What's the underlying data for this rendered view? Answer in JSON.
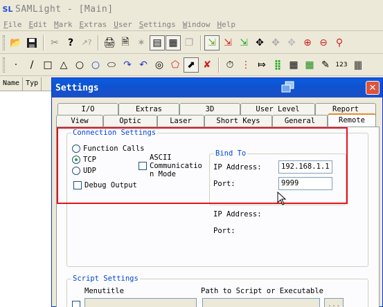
{
  "app": {
    "logo": "SL",
    "title": "SAMLight - [Main]"
  },
  "menu": [
    "File",
    "Edit",
    "Mark",
    "Extras",
    "User",
    "Settings",
    "Window",
    "Help"
  ],
  "left_panel": {
    "col_name": "Name",
    "col_type": "Typ"
  },
  "dialog": {
    "title": "Settings",
    "close": "✕",
    "tabs_row1": [
      "I/O",
      "Extras",
      "3D",
      "User Level",
      "Report"
    ],
    "tabs_row2": [
      "View",
      "Optic",
      "Laser",
      "Short Keys",
      "General",
      "Remote"
    ],
    "active_tab": "Remote",
    "connection": {
      "label": "Connection Settings",
      "radio_function_calls": "Function Calls",
      "radio_tcp": "TCP",
      "radio_udp": "UDP",
      "selected": "TCP",
      "ascii_label": "ASCII Communication Mode",
      "ascii_line1": "ASCII",
      "ascii_line2": "Communicatio",
      "ascii_line3": "n Mode",
      "debug_output": "Debug Output",
      "bind_to": {
        "label": "Bind To",
        "ip_label": "IP Address:",
        "ip_value": "192.168.1.1",
        "port_label": "Port:",
        "port_value": "9999"
      },
      "ip_label_2": "IP Address:",
      "port_label_2": "Port:"
    },
    "script": {
      "label": "Script Settings",
      "col_menutitle": "Menutitle",
      "col_path": "Path to Script or Executable",
      "browse": "..."
    }
  }
}
